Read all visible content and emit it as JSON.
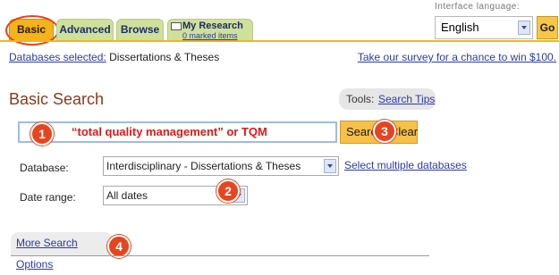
{
  "tabs": {
    "basic": "Basic",
    "advanced": "Advanced",
    "browse": "Browse",
    "my_research": "My Research",
    "marked_items": "0 marked items"
  },
  "interface_language": {
    "label": "Interface language:",
    "selected": "English",
    "go": "Go"
  },
  "databases_selected": {
    "link": "Databases selected:",
    "value": " Dissertations & Theses"
  },
  "survey_link": "Take our survey for a chance to win $100.",
  "page_title": "Basic Search",
  "tools": {
    "label": "Tools:",
    "search_tips": "Search Tips"
  },
  "search": {
    "query": "“total quality management” or TQM",
    "search_label": "Search",
    "clear_label": "Clear"
  },
  "database": {
    "label": "Database:",
    "selected": "Interdisciplinary - Dissertations & Theses",
    "multiple_link": "Select multiple databases"
  },
  "date_range": {
    "label": "Date range:",
    "selected": "All dates"
  },
  "more_options": "More Search Options",
  "badges": [
    "1",
    "2",
    "3",
    "4"
  ],
  "colors": {
    "accent_gold": "#f2b51c",
    "tab_green": "#cfe09a",
    "badge_red": "#e6451f",
    "query_red": "#e01818",
    "link_blue": "#2a3aa8",
    "title_brown": "#8a3a1a"
  }
}
